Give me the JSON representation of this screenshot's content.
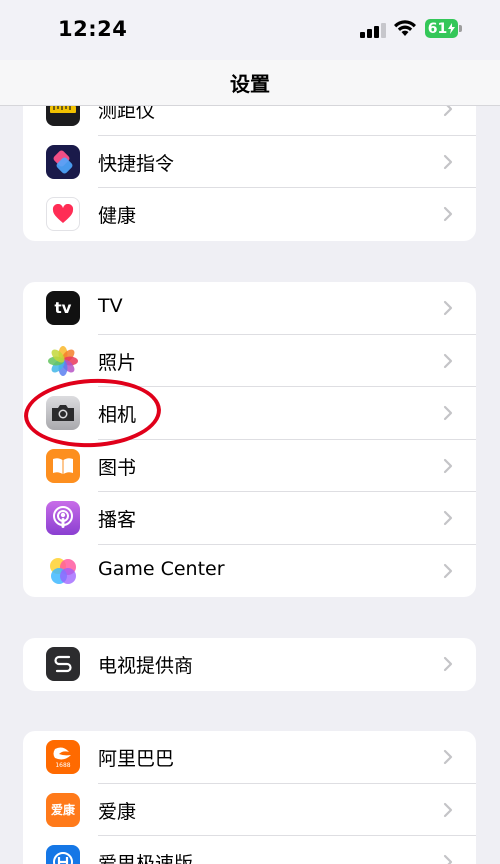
{
  "status": {
    "time": "12:24",
    "battery": "61"
  },
  "nav": {
    "title": "设置"
  },
  "groups": [
    {
      "items": [
        {
          "label": "测距仪",
          "icon": "measure-icon"
        },
        {
          "label": "快捷指令",
          "icon": "shortcuts-icon"
        },
        {
          "label": "健康",
          "icon": "health-icon"
        }
      ]
    },
    {
      "items": [
        {
          "label": "TV",
          "icon": "apple-tv-icon",
          "icon_text": "tv"
        },
        {
          "label": "照片",
          "icon": "photos-icon"
        },
        {
          "label": "相机",
          "icon": "camera-icon"
        },
        {
          "label": "图书",
          "icon": "books-icon"
        },
        {
          "label": "播客",
          "icon": "podcasts-icon"
        },
        {
          "label": "Game Center",
          "icon": "game-center-icon"
        }
      ]
    },
    {
      "items": [
        {
          "label": "电视提供商",
          "icon": "tv-provider-icon"
        }
      ]
    },
    {
      "items": [
        {
          "label": "阿里巴巴",
          "icon": "alibaba-icon",
          "icon_text": "1688"
        },
        {
          "label": "爱康",
          "icon": "aikang-icon",
          "icon_text": "爱康"
        },
        {
          "label": "爱思极速版",
          "icon": "aisi-icon"
        }
      ]
    }
  ],
  "colors": {
    "accent_annotation": "#e0001a",
    "battery": "#34c759",
    "background": "#efeff4"
  }
}
